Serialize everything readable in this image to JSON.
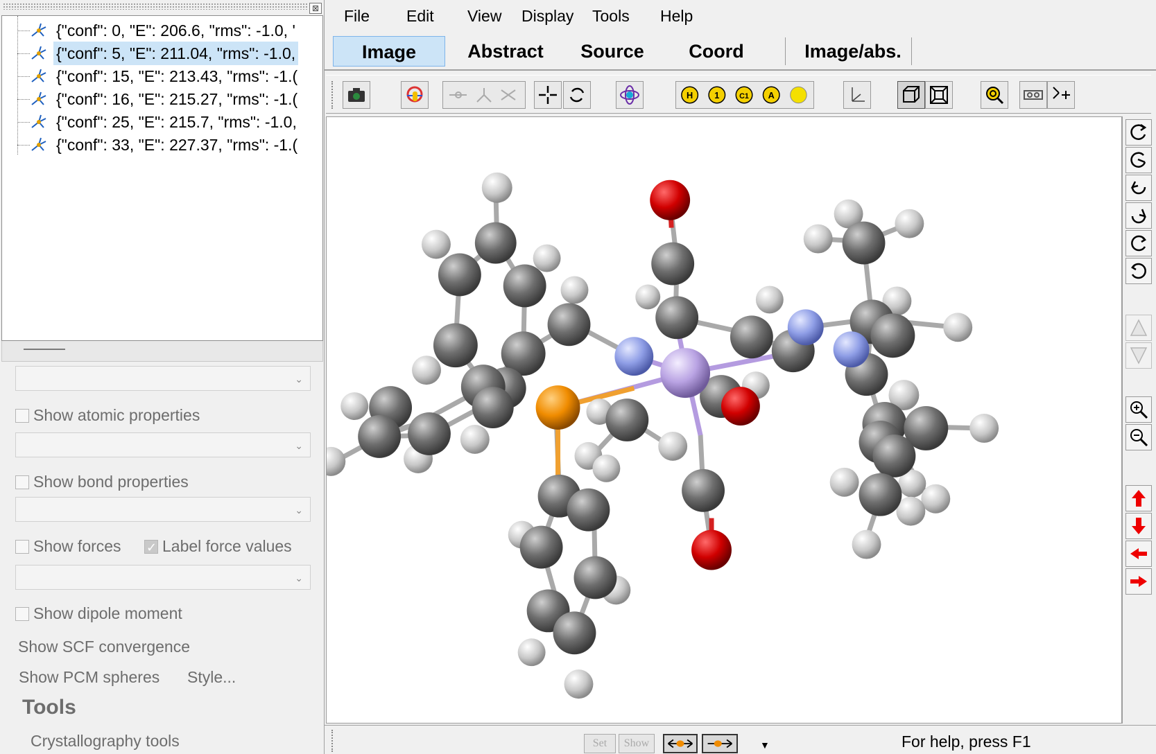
{
  "tree": {
    "items": [
      {
        "label": "{\"conf\": 0, \"E\": 206.6, \"rms\": -1.0, '",
        "selected": false
      },
      {
        "label": "{\"conf\": 5, \"E\": 211.04, \"rms\": -1.0,",
        "selected": true
      },
      {
        "label": "{\"conf\": 15, \"E\": 213.43, \"rms\": -1.(",
        "selected": false
      },
      {
        "label": "{\"conf\": 16, \"E\": 215.27, \"rms\": -1.(",
        "selected": false
      },
      {
        "label": "{\"conf\": 25, \"E\": 215.7, \"rms\": -1.0,",
        "selected": false
      },
      {
        "label": "{\"conf\": 33, \"E\": 227.37, \"rms\": -1.(",
        "selected": false
      }
    ],
    "close_glyph": "⊠"
  },
  "properties": {
    "show_atomic": "Show atomic properties",
    "show_bond": "Show bond properties",
    "show_forces": "Show forces",
    "label_force_values": "Label force values",
    "show_dipole": "Show dipole moment",
    "show_scf": "Show SCF convergence",
    "show_pcm": "Show PCM spheres",
    "style": "Style...",
    "tools_heading": "Tools",
    "crystallography": "Crystallography tools",
    "combo_arrow": "⌄"
  },
  "menu": {
    "file": "File",
    "edit": "Edit",
    "view": "View",
    "display": "Display",
    "tools": "Tools",
    "help": "Help"
  },
  "tabs": {
    "image": "Image",
    "abstract": "Abstract",
    "source": "Source",
    "coord": "Coord",
    "image_abs": "Image/abs."
  },
  "statusbar": {
    "set": "Set",
    "show": "Show",
    "dropdown_glyph": "▼",
    "help_text": "For help, press F1"
  },
  "toolbar_labels": {
    "h": "H",
    "one": "1",
    "c1": "C1",
    "a": "A"
  },
  "colors": {
    "selected_bg": "#cce4f7",
    "carbon": "#7a7a7a",
    "hydrogen": "#d0d0d0",
    "oxygen": "#d00000",
    "nitrogen": "#8f9ee6",
    "phosphorus": "#f08c00",
    "metal": "#b9a3e3"
  }
}
